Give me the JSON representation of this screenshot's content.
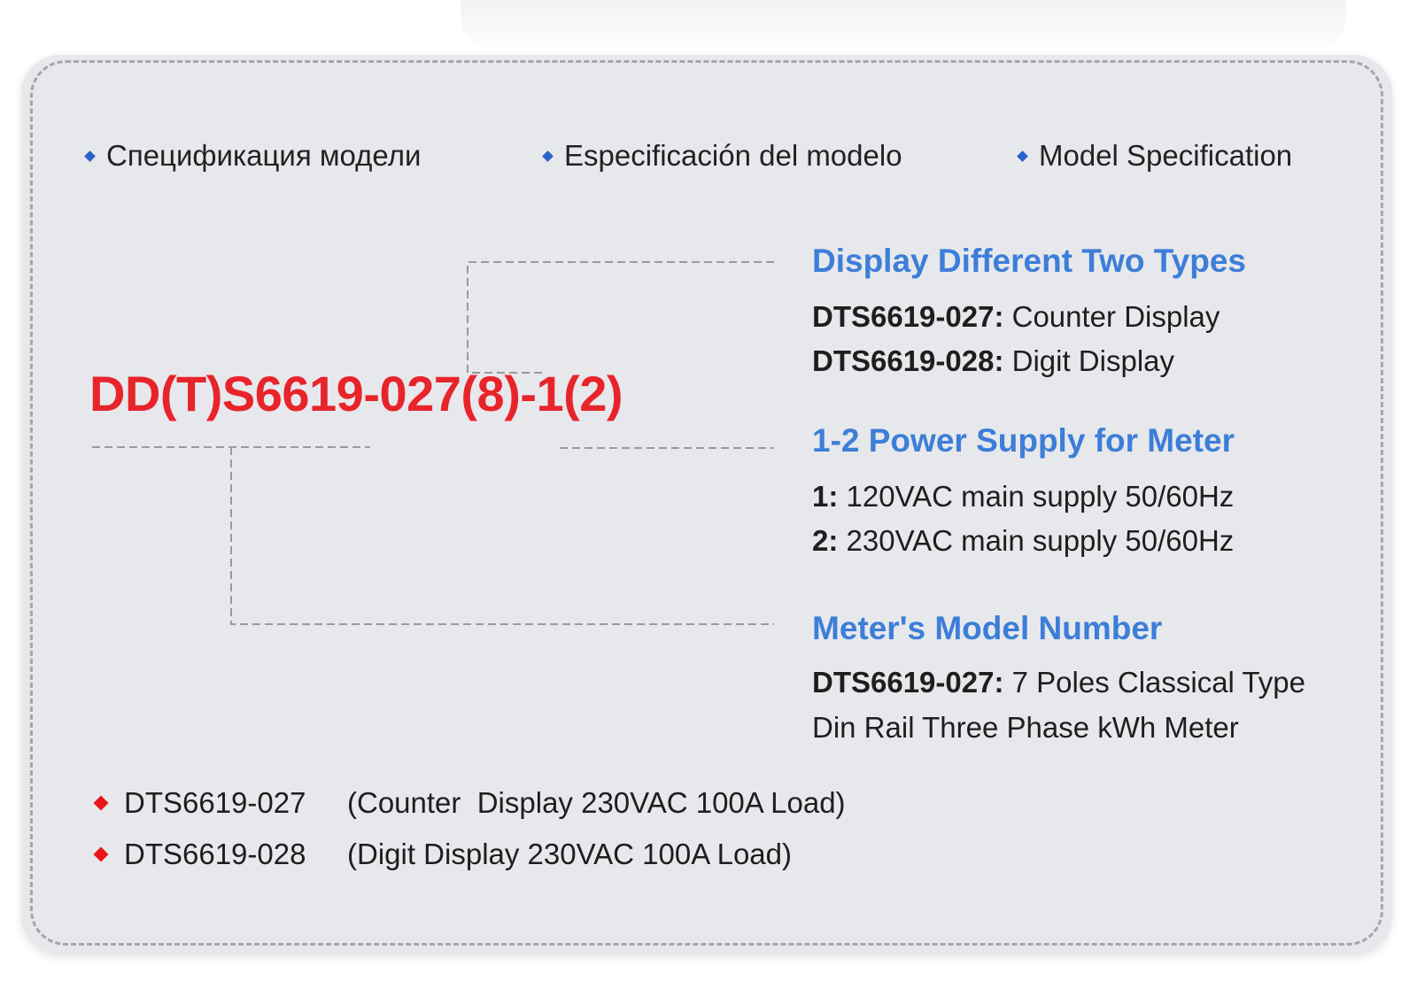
{
  "headings": [
    "Спецификация модели",
    "Especificación del modelo",
    "Model Specification"
  ],
  "model_code": "DD(T)S6619-027(8)-1(2)",
  "sections": {
    "display": {
      "title": "Display Different Two Types",
      "lines": [
        {
          "key": "DTS6619-027:",
          "value": " Counter Display"
        },
        {
          "key": "DTS6619-028:",
          "value": " Digit Display"
        }
      ]
    },
    "power": {
      "title": "1-2 Power Supply for Meter",
      "lines": [
        {
          "key": "1:",
          "value": " 120VAC main supply 50/60Hz"
        },
        {
          "key": "2:",
          "value": " 230VAC main supply 50/60Hz"
        }
      ]
    },
    "model": {
      "title": "Meter's Model Number",
      "lines": [
        {
          "key": "DTS6619-027:",
          "value": " 7 Poles Classical Type"
        },
        {
          "key": "",
          "value": "Din Rail Three Phase kWh Meter"
        }
      ]
    }
  },
  "variants": [
    {
      "code": "DTS6619-027",
      "desc": "(Counter  Display 230VAC 100A Load)"
    },
    {
      "code": "DTS6619-028",
      "desc": "(Digit Display 230VAC 100A Load)"
    }
  ],
  "colors": {
    "title_blue": "#3c7ed8",
    "code_red": "#e8242b",
    "bullet_blue": "#2a62c9",
    "bullet_red": "#e8151b",
    "card_bg": "#e7e8ec"
  }
}
